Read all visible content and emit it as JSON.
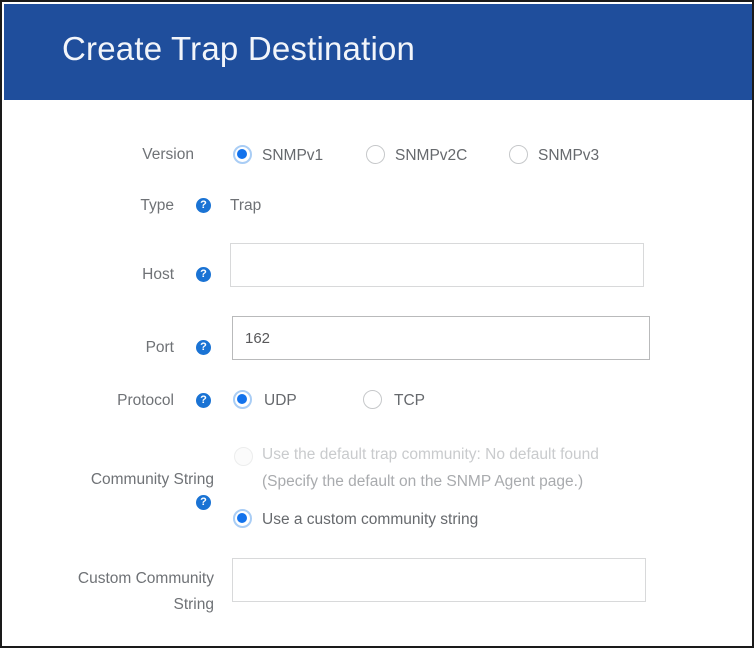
{
  "dialog": {
    "title": "Create Trap Destination"
  },
  "fields": {
    "version": {
      "label": "Version",
      "options": [
        {
          "label": "SNMPv1",
          "selected": true
        },
        {
          "label": "SNMPv2C",
          "selected": false
        },
        {
          "label": "SNMPv3",
          "selected": false
        }
      ]
    },
    "type": {
      "label": "Type",
      "help": "?",
      "value": "Trap"
    },
    "host": {
      "label": "Host",
      "help": "?",
      "value": "",
      "placeholder": ""
    },
    "port": {
      "label": "Port",
      "help": "?",
      "value": "162",
      "placeholder": ""
    },
    "protocol": {
      "label": "Protocol",
      "help": "?",
      "options": [
        {
          "label": "UDP",
          "selected": true
        },
        {
          "label": "TCP",
          "selected": false
        }
      ]
    },
    "community_string": {
      "label": "Community String",
      "help": "?",
      "default_option_line1": "Use the default trap community: No default found",
      "default_option_line2": "(Specify the default on the SNMP Agent page.)",
      "custom_option": "Use a custom community string"
    },
    "custom_community_string": {
      "label_line1": "Custom Community",
      "label_line2": "String",
      "value": "",
      "placeholder": ""
    }
  },
  "colors": {
    "header_blue": "#1F4E9C",
    "radio_accent": "#1272EC",
    "help_icon_blue": "#1A73D4",
    "label_gray": "#6F7276",
    "border_gray": "#D8D9DA"
  }
}
